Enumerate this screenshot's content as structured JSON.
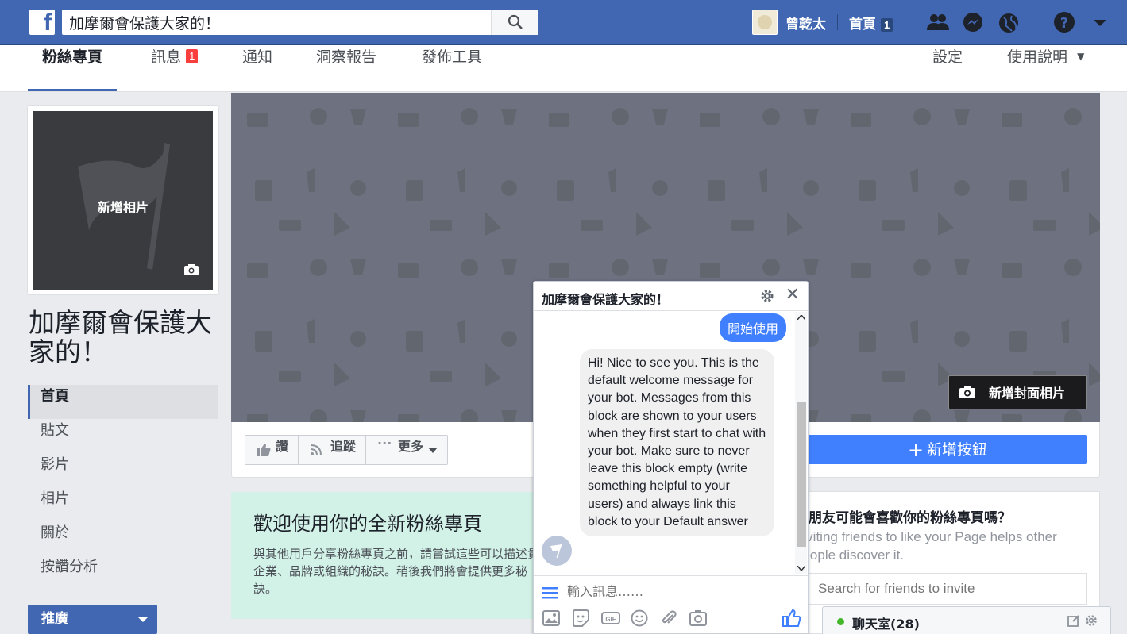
{
  "topbar": {
    "logo": "f",
    "search_value": "加摩爾會保護大家的！",
    "user_name": "曾乾太",
    "home_label": "首頁",
    "home_count": "1"
  },
  "pagenav": {
    "tabs": [
      {
        "label": "粉絲專頁"
      },
      {
        "label": "訊息",
        "badge": "1"
      },
      {
        "label": "通知"
      },
      {
        "label": "洞察報告"
      },
      {
        "label": "發佈工具"
      }
    ],
    "settings": "設定",
    "help": "使用說明",
    "help_caret": "▼"
  },
  "profile": {
    "add_photo": "新增相片",
    "page_title": "加摩爾會保護大家的！"
  },
  "leftnav": {
    "items": [
      "首頁",
      "貼文",
      "影片",
      "相片",
      "關於",
      "按讚分析"
    ],
    "promote": "推廣"
  },
  "cover": {
    "add_cover": "新增封面相片"
  },
  "actions": {
    "like": "讚",
    "follow": "追蹤",
    "more": "更多",
    "add_button": "新增按鈕"
  },
  "welcome": {
    "title": "歡迎使用你的全新粉絲專頁",
    "text": "與其他用戶分享粉絲專頁之前，請嘗試這些可以描述貴企業、品牌或組織的秘訣。稍後我們將會提供更多秘訣。"
  },
  "invite": {
    "title": "有朋友可能會喜歡你的粉絲專頁嗎？",
    "text": "Inviting friends to like your Page helps other people discover it.",
    "placeholder": "Search for friends to invite"
  },
  "chat": {
    "title": "加摩爾會保護大家的！",
    "user_message": "開始使用",
    "bot_message": "Hi! Nice to see you. This is the default welcome message for your bot. Messages from this block are shown to your users when they first start to chat with your bot. Make sure to never leave this block empty (write something helpful to your users) and always link this block to your Default answer",
    "input_placeholder": "輸入訊息……",
    "chatbar_label": "聊天室(28)"
  },
  "colors": {
    "brand_blue": "#4267b2",
    "button_blue": "#4080ff",
    "badge_red": "#fa3e3e",
    "online_green": "#42b72a"
  }
}
